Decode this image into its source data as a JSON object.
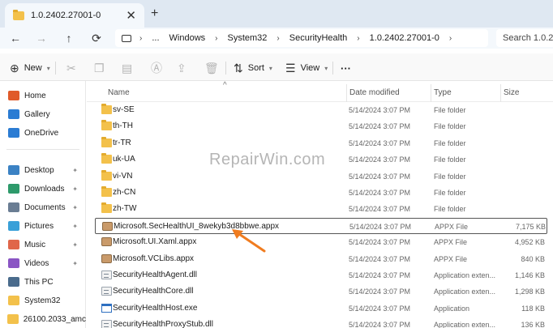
{
  "tab": {
    "title": "1.0.2402.27001-0",
    "close_icon": "close-icon",
    "new_tab_icon": "plus-icon"
  },
  "nav": {
    "back": "←",
    "forward": "→",
    "up": "↑",
    "refresh": "⟳"
  },
  "address": {
    "more": "...",
    "crumbs": [
      "Windows",
      "System32",
      "SecurityHealth",
      "1.0.2402.27001-0"
    ],
    "separator": "›"
  },
  "search": {
    "placeholder": "Search 1.0.240"
  },
  "toolbar": {
    "new_label": "New",
    "sort_label": "Sort",
    "view_label": "View",
    "more_label": "···"
  },
  "sidebar": {
    "items": [
      {
        "label": "Home",
        "icon": "home-icon",
        "color": "#e05a2a"
      },
      {
        "label": "Gallery",
        "icon": "gallery-icon",
        "color": "#2b7cd3"
      },
      {
        "label": "OneDrive",
        "icon": "cloud-icon",
        "color": "#2b7cd3"
      },
      {
        "label": "Desktop",
        "icon": "desktop-icon",
        "color": "#3b82c4"
      },
      {
        "label": "Downloads",
        "icon": "download-icon",
        "color": "#2e9a6b"
      },
      {
        "label": "Documents",
        "icon": "documents-icon",
        "color": "#6a7d93"
      },
      {
        "label": "Pictures",
        "icon": "pictures-icon",
        "color": "#3aa0d8"
      },
      {
        "label": "Music",
        "icon": "music-icon",
        "color": "#e0664a"
      },
      {
        "label": "Videos",
        "icon": "videos-icon",
        "color": "#8a55c4"
      },
      {
        "label": "This PC",
        "icon": "pc-icon",
        "color": "#4a6b8c"
      },
      {
        "label": "System32",
        "icon": "folder-icon",
        "color": "#f3c14b"
      },
      {
        "label": "26100.2033_amc",
        "icon": "folder-icon",
        "color": "#f3c14b"
      }
    ]
  },
  "columns": {
    "name": "Name",
    "date": "Date modified",
    "type": "Type",
    "size": "Size",
    "sort_indicator": "^"
  },
  "files": [
    {
      "name": "sv-SE",
      "date": "5/14/2024 3:07 PM",
      "type": "File folder",
      "size": "",
      "kind": "folder"
    },
    {
      "name": "th-TH",
      "date": "5/14/2024 3:07 PM",
      "type": "File folder",
      "size": "",
      "kind": "folder"
    },
    {
      "name": "tr-TR",
      "date": "5/14/2024 3:07 PM",
      "type": "File folder",
      "size": "",
      "kind": "folder"
    },
    {
      "name": "uk-UA",
      "date": "5/14/2024 3:07 PM",
      "type": "File folder",
      "size": "",
      "kind": "folder"
    },
    {
      "name": "vi-VN",
      "date": "5/14/2024 3:07 PM",
      "type": "File folder",
      "size": "",
      "kind": "folder"
    },
    {
      "name": "zh-CN",
      "date": "5/14/2024 3:07 PM",
      "type": "File folder",
      "size": "",
      "kind": "folder"
    },
    {
      "name": "zh-TW",
      "date": "5/14/2024 3:07 PM",
      "type": "File folder",
      "size": "",
      "kind": "folder"
    },
    {
      "name": "Microsoft.SecHealthUI_8wekyb3d8bbwe.appx",
      "date": "5/14/2024 3:07 PM",
      "type": "APPX File",
      "size": "7,175 KB",
      "kind": "appx",
      "selected": true
    },
    {
      "name": "Microsoft.UI.Xaml.appx",
      "date": "5/14/2024 3:07 PM",
      "type": "APPX File",
      "size": "4,952 KB",
      "kind": "appx"
    },
    {
      "name": "Microsoft.VCLibs.appx",
      "date": "5/14/2024 3:07 PM",
      "type": "APPX File",
      "size": "840 KB",
      "kind": "appx"
    },
    {
      "name": "SecurityHealthAgent.dll",
      "date": "5/14/2024 3:07 PM",
      "type": "Application exten...",
      "size": "1,146 KB",
      "kind": "dll"
    },
    {
      "name": "SecurityHealthCore.dll",
      "date": "5/14/2024 3:07 PM",
      "type": "Application exten...",
      "size": "1,298 KB",
      "kind": "dll"
    },
    {
      "name": "SecurityHealthHost.exe",
      "date": "5/14/2024 3:07 PM",
      "type": "Application",
      "size": "118 KB",
      "kind": "exe"
    },
    {
      "name": "SecurityHealthProxyStub.dll",
      "date": "5/14/2024 3:07 PM",
      "type": "Application exten...",
      "size": "136 KB",
      "kind": "dll"
    }
  ],
  "watermark": "RepairWin.com",
  "colors": {
    "arrow": "#f07c1f",
    "titlebar": "#dfe8f2",
    "folder": "#f3c14b"
  }
}
